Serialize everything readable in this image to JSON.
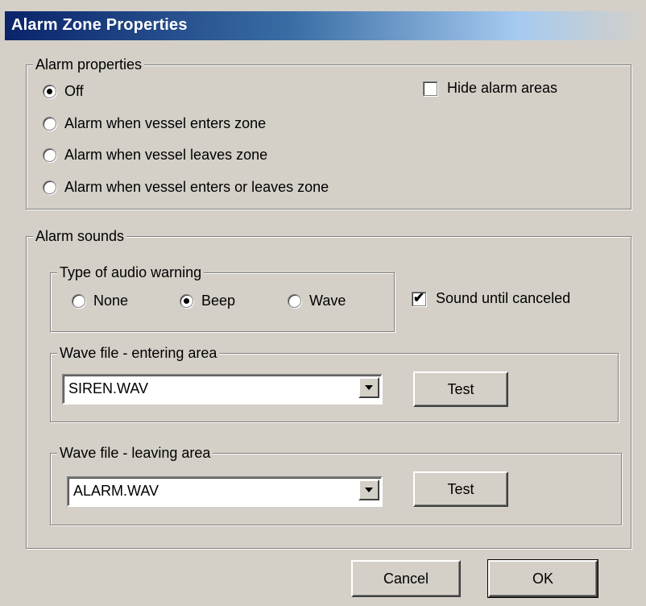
{
  "dialog": {
    "title": "Alarm Zone Properties"
  },
  "alarm_properties": {
    "legend": "Alarm properties",
    "options": [
      {
        "label": "Off",
        "selected": true
      },
      {
        "label": "Alarm when vessel enters zone",
        "selected": false
      },
      {
        "label": "Alarm when vessel leaves zone",
        "selected": false
      },
      {
        "label": "Alarm when vessel enters or leaves zone",
        "selected": false
      }
    ],
    "hide_alarm_areas": {
      "label": "Hide alarm areas",
      "checked": false
    }
  },
  "alarm_sounds": {
    "legend": "Alarm sounds",
    "audio_warning": {
      "legend": "Type of audio warning",
      "options": [
        {
          "label": "None",
          "selected": false
        },
        {
          "label": "Beep",
          "selected": true
        },
        {
          "label": "Wave",
          "selected": false
        }
      ]
    },
    "sound_until_canceled": {
      "label": "Sound until canceled",
      "checked": true,
      "mark": "✔"
    },
    "wave_entering": {
      "legend": "Wave file - entering area",
      "value": "SIREN.WAV",
      "test_label": "Test"
    },
    "wave_leaving": {
      "legend": "Wave file - leaving area",
      "value": "ALARM.WAV",
      "test_label": "Test"
    }
  },
  "buttons": {
    "cancel_label": "Cancel",
    "ok_label": "OK"
  },
  "colors": {
    "face": "#d4d0c8",
    "title_gradient_start": "#0a246a",
    "title_gradient_end": "#a6caf0"
  }
}
